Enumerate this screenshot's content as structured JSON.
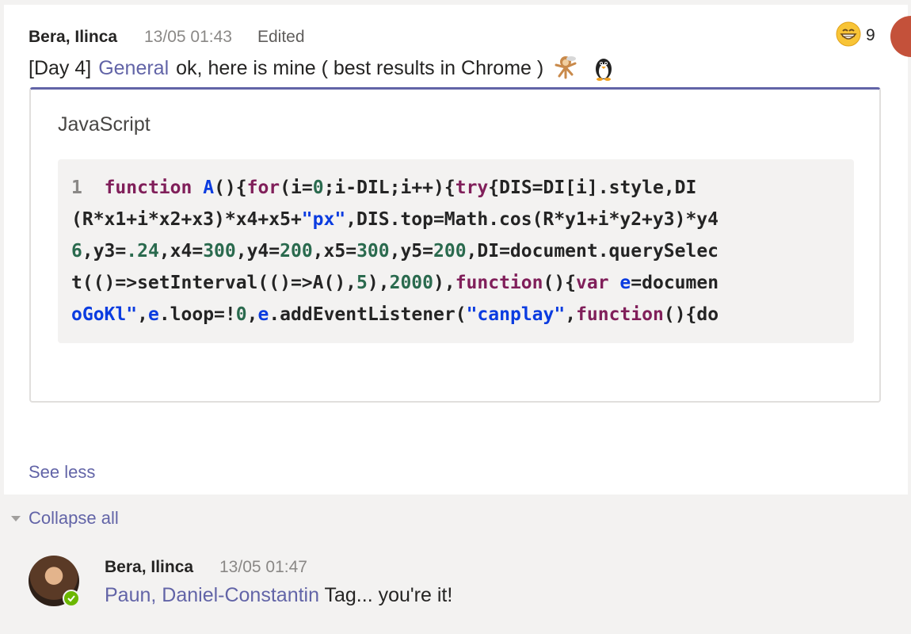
{
  "message": {
    "author": "Bera, Ilinca",
    "time": "13/05 01:43",
    "edited": "Edited",
    "body_prefix": "[Day 4]",
    "channel": "General",
    "body_text": "ok, here is mine ( best results in Chrome )",
    "emojis": [
      "monkey-emoji",
      "penguin-emoji"
    ],
    "reaction": {
      "icon": "grinning-face-icon",
      "count": "9"
    }
  },
  "code": {
    "language": "JavaScript",
    "line_number": "1",
    "lines": [
      "function A(){for(i=0;i-DIL;i++){try{DIS=DI[i].style,DI",
      "(R*x1+i*x2+x3)*x4+x5+\"px\",DIS.top=Math.cos(R*y1+i*y2+y3)*y4",
      "6,y3=.24,x4=300,y4=200,x5=300,y5=200,DI=document.querySelec",
      "t(()=>setInterval(()=>A(),5),2000),function(){var e=documen",
      "oGoKl\",e.loop=!0,e.addEventListener(\"canplay\",function(){do"
    ]
  },
  "see_less": "See less",
  "collapse_all": "Collapse all",
  "reply": {
    "author": "Bera, Ilinca",
    "time": "13/05 01:47",
    "mention": "Paun, Daniel-Constantin",
    "text": "Tag... you're it!"
  },
  "colors": {
    "accent": "#6264a7",
    "status_available": "#6bb700"
  }
}
